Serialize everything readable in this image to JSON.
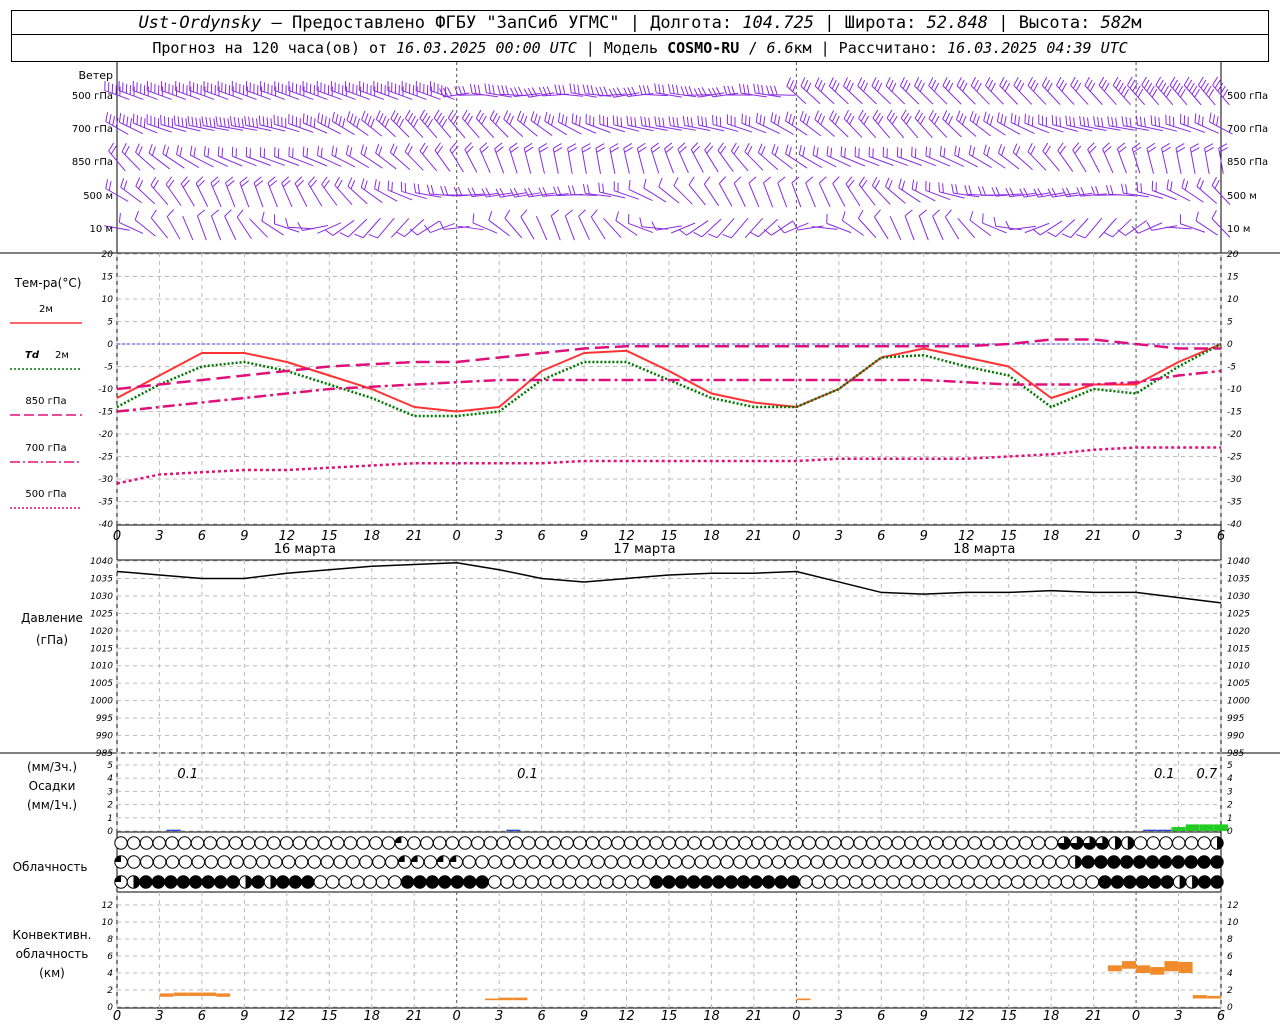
{
  "header": {
    "station": "Ust-Ordynsky",
    "sep1": " – Предоставлено ФГБУ \"ЗапСиб УГМС\" | Долгота: ",
    "lon": "104.725",
    "sep2": " | Широта: ",
    "lat": "52.848",
    "sep3": " | Высота: ",
    "alt": "582",
    "alt_unit": "м",
    "forecast_prefix": "Прогноз на 120 часа(ов) от ",
    "forecast_start": "16.03.2025 00:00 UTC",
    "model_prefix": "  | Модель ",
    "model": "COSMO-RU",
    "res_sep": " / ",
    "res": "6.6",
    "res_unit": "км",
    "calc_prefix": " | Рассчитано: ",
    "calc_time": "16.03.2025 04:39 UTC"
  },
  "axes": {
    "hour_ticks": [
      "0",
      "3",
      "6",
      "9",
      "12",
      "15",
      "18",
      "21",
      "0",
      "3",
      "6",
      "9",
      "12",
      "15",
      "18",
      "21",
      "0",
      "3",
      "6",
      "9",
      "12",
      "15",
      "18",
      "21",
      "0",
      "3",
      "6"
    ],
    "day_labels": [
      "16 марта",
      "17 марта",
      "18 марта"
    ]
  },
  "wind_panel": {
    "title": "Ветер",
    "levels": [
      "500 гПа",
      "700 гПа",
      "850 гПа",
      "500 м",
      "10  м"
    ],
    "color": "#8a2be2"
  },
  "temp_panel": {
    "title": "Тем-ра(°C)",
    "yticks": [
      "20",
      "15",
      "10",
      "5",
      "0",
      "-5",
      "-10",
      "-15",
      "-20",
      "-25",
      "-30",
      "-35",
      "-40"
    ],
    "legend": [
      {
        "label": "2м",
        "color": "#ff3333",
        "style": "solid"
      },
      {
        "label_a": "Td",
        "label_b": "2м",
        "color": "#007700",
        "style": "dotted"
      },
      {
        "label": "850 гПа",
        "color": "#e0107a",
        "style": "longdash"
      },
      {
        "label": "700 гПа",
        "color": "#e0107a",
        "style": "dashdot"
      },
      {
        "label": "500 гПа",
        "color": "#e0107a",
        "style": "dotted"
      }
    ]
  },
  "pressure_panel": {
    "title1": "Давление",
    "title2": "(гПа)",
    "yticks": [
      "1040",
      "1035",
      "1030",
      "1025",
      "1020",
      "1015",
      "1010",
      "1005",
      "1000",
      "995",
      "990",
      "985"
    ]
  },
  "precip_panel": {
    "title1": "(мм/3ч.)",
    "title2": "Осадки",
    "title3": "(мм/1ч.)",
    "yticks": [
      "5",
      "4",
      "3",
      "2",
      "1",
      "0"
    ],
    "labels": [
      {
        "hour": 5,
        "text": "0.1"
      },
      {
        "hour": 29,
        "text": "0.1"
      },
      {
        "hour": 74,
        "text": "0.1"
      },
      {
        "hour": 77,
        "text": "0.7"
      }
    ]
  },
  "cloud_panel": {
    "title": "Облачность"
  },
  "conv_panel": {
    "title1": "Конвективн.",
    "title2": "облачность",
    "title3": "(км)",
    "yticks": [
      "12",
      "10",
      "8",
      "6",
      "4",
      "2",
      "0"
    ]
  },
  "chart_data": [
    {
      "type": "line",
      "title": "Тем-ра(°C)",
      "x_hours": [
        0,
        3,
        6,
        9,
        12,
        15,
        18,
        21,
        24,
        27,
        30,
        33,
        36,
        39,
        42,
        45,
        48,
        51,
        54,
        57,
        60,
        63,
        66,
        69,
        72,
        75,
        78
      ],
      "ylim": [
        -40,
        20
      ],
      "series": [
        {
          "name": "2м",
          "values": [
            -12,
            -7,
            -2,
            -2,
            -4,
            -7,
            -10,
            -14,
            -15,
            -14,
            -6,
            -2,
            -1.5,
            -6,
            -11,
            -13,
            -14,
            -10,
            -3,
            -1,
            -3,
            -5,
            -12,
            -9,
            -9,
            -4,
            0
          ]
        },
        {
          "name": "Td 2м",
          "values": [
            -14,
            -9,
            -5,
            -4,
            -6,
            -9,
            -12,
            -16,
            -16,
            -15,
            -8,
            -4,
            -4,
            -8,
            -12,
            -14,
            -14,
            -10,
            -3,
            -2.5,
            -5,
            -7,
            -14,
            -10,
            -11,
            -5,
            0
          ]
        },
        {
          "name": "850 гПа",
          "values": [
            -10,
            -9,
            -8,
            -7,
            -6,
            -5,
            -4.5,
            -4,
            -4,
            -3,
            -2,
            -1,
            -0.5,
            -0.5,
            -0.5,
            -0.5,
            -0.5,
            -0.5,
            -0.5,
            -0.5,
            -0.5,
            0,
            1,
            1,
            0,
            -1,
            -1
          ]
        },
        {
          "name": "700 гПа",
          "values": [
            -15,
            -14,
            -13,
            -12,
            -11,
            -10,
            -9.5,
            -9,
            -8.5,
            -8,
            -8,
            -8,
            -8,
            -8,
            -8,
            -8,
            -8,
            -8,
            -8,
            -8,
            -8.5,
            -9,
            -9,
            -9,
            -8.5,
            -7,
            -6
          ]
        },
        {
          "name": "500 гПа",
          "values": [
            -31,
            -29,
            -28.5,
            -28,
            -28,
            -27.5,
            -27,
            -26.5,
            -26.5,
            -26.5,
            -26.5,
            -26,
            -26,
            -26,
            -26,
            -26,
            -26,
            -25.5,
            -25.5,
            -25.5,
            -25.5,
            -25,
            -24.5,
            -23.5,
            -23,
            -23,
            -23
          ]
        }
      ]
    },
    {
      "type": "line",
      "title": "Давление (гПа)",
      "x_hours": [
        0,
        3,
        6,
        9,
        12,
        15,
        18,
        21,
        24,
        27,
        30,
        33,
        36,
        39,
        42,
        45,
        48,
        51,
        54,
        57,
        60,
        63,
        66,
        69,
        72,
        75,
        78
      ],
      "ylim": [
        985,
        1040
      ],
      "series": [
        {
          "name": "Давление",
          "values": [
            1037,
            1036,
            1035,
            1035,
            1036.5,
            1037.5,
            1038.5,
            1039,
            1039.5,
            1037.5,
            1035,
            1034,
            1035,
            1036,
            1036.5,
            1036.5,
            1037,
            1034,
            1031,
            1030.5,
            1031,
            1031,
            1031.5,
            1031,
            1031,
            1029.5,
            1028
          ]
        }
      ]
    },
    {
      "type": "bar",
      "title": "Осадки",
      "x_hours": [
        3,
        4,
        5,
        27,
        28,
        29,
        73,
        74,
        75,
        76,
        77,
        78
      ],
      "ylim": [
        0,
        5
      ],
      "series": [
        {
          "name": "мм/3ч.",
          "values": [
            0,
            0.1,
            0,
            0,
            0.1,
            0,
            0.1,
            0.1,
            0.3,
            0.5,
            0.5,
            0.5
          ]
        }
      ]
    },
    {
      "type": "bar",
      "title": "Конвективн. облачность (км)",
      "ylim": [
        0,
        12
      ],
      "series": [
        {
          "name": "base",
          "x_hours": [
            3.5,
            4.5,
            5.5,
            6.5,
            7.5,
            26.5,
            27.5,
            28.5,
            48.5,
            70.5,
            71.5,
            72.5,
            73.5,
            74.5,
            75.5,
            76.5,
            77.5
          ],
          "values": [
            1.2,
            1.3,
            1.3,
            1.3,
            1.2,
            0.8,
            0.8,
            0.8,
            0.8,
            4.2,
            4.5,
            4.0,
            3.8,
            4.2,
            4.0,
            1.0,
            1.0
          ]
        },
        {
          "name": "top",
          "x_hours": [
            3.5,
            4.5,
            5.5,
            6.5,
            7.5,
            26.5,
            27.5,
            28.5,
            48.5,
            70.5,
            71.5,
            72.5,
            73.5,
            74.5,
            75.5,
            76.5,
            77.5
          ],
          "values": [
            1.6,
            1.7,
            1.7,
            1.7,
            1.6,
            1.0,
            1.1,
            1.1,
            1.0,
            4.9,
            5.4,
            4.9,
            4.7,
            5.4,
            5.3,
            1.4,
            1.3
          ]
        }
      ]
    }
  ],
  "clouds": {
    "rows": [
      "OOOOOOOOOOOOOOOOOOOOOOQOOOOOOOOOOOOOOOOOOOOOOOOOOOOOOOOOOOOOOOOOOOOOOOOOOOTTTTHHOOOOOOH",
      "QOOOOOOOOOOOOOOOOOOOOOQQOQQOOOOOOOOOOOOOOOOOOOOOOOOOOOOOOOOOOOOOOOOOOOOOOOHXXXXXXXXXXX",
      "QHXXXXXXXXHXHXXXOOOOOOOXXXXXXXOOOOOOOOOOOOOXXXXXXXXXXXXOOOOOOOOOOOOOOOOOOOOOOOOXXXXXXHHXX"
    ]
  }
}
